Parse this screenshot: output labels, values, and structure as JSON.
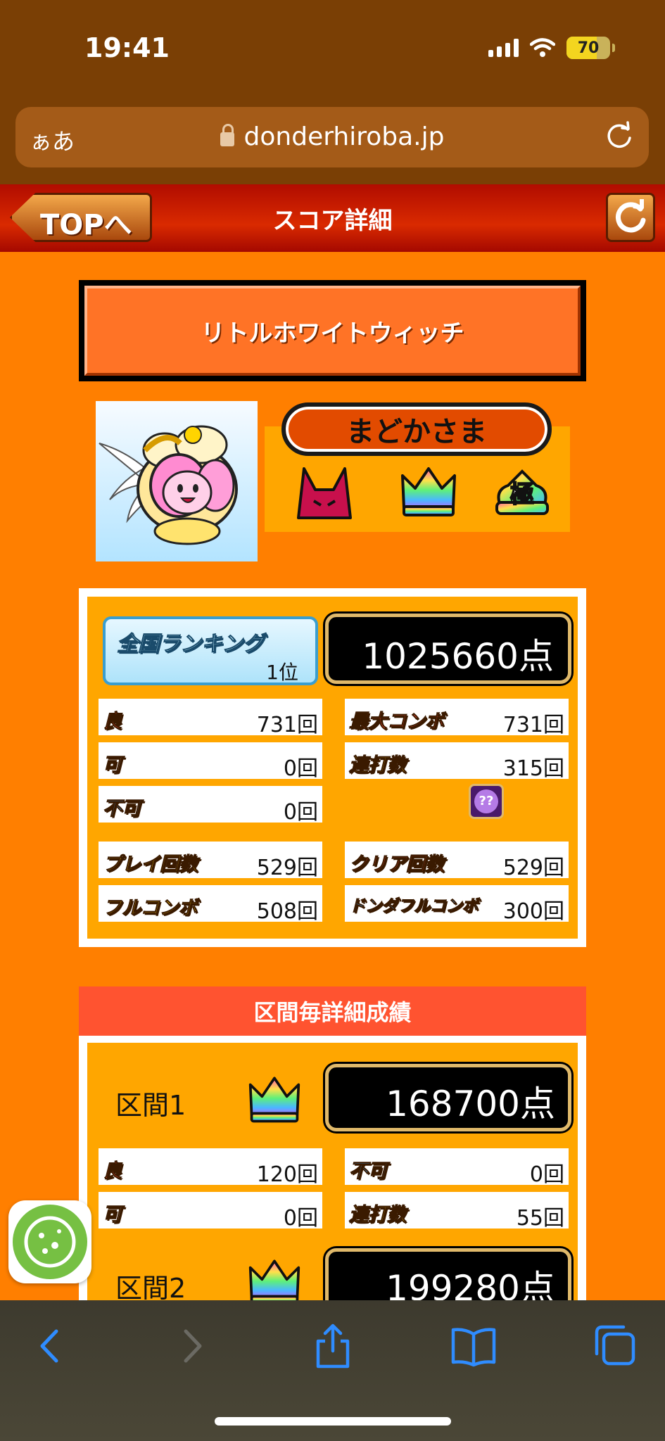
{
  "status_bar": {
    "time": "19:41",
    "battery": "70"
  },
  "url_bar": {
    "text_size": "ぁあ",
    "domain": "donderhiroba.jp"
  },
  "header": {
    "back_label": "TOPへ",
    "title": "スコア詳細"
  },
  "song": {
    "title": "リトルホワイトウィッチ"
  },
  "player": {
    "name": "まどかさま",
    "badges": [
      "oni-difficulty-icon",
      "rainbow-crown-icon",
      "kiwami-rank-icon"
    ]
  },
  "score": {
    "ranking_label": "全国ランキング",
    "ranking_value": "1位",
    "total": "1025660点",
    "stats": {
      "good": {
        "label": "良",
        "value": "731回"
      },
      "ok": {
        "label": "可",
        "value": "0回"
      },
      "bad": {
        "label": "不可",
        "value": "0回"
      },
      "max_combo": {
        "label": "最大コンボ",
        "value": "731回"
      },
      "drumroll": {
        "label": "連打数",
        "value": "315回"
      },
      "play_count": {
        "label": "プレイ回数",
        "value": "529回"
      },
      "full_combo": {
        "label": "フルコンボ",
        "value": "508回"
      },
      "clear_count": {
        "label": "クリア回数",
        "value": "529回"
      },
      "donderful_combo": {
        "label": "ドンダフルコンボ",
        "value": "300回"
      }
    }
  },
  "sections": {
    "header": "区間毎詳細成績",
    "items": [
      {
        "title": "区間1",
        "score": "168700点",
        "good": {
          "label": "良",
          "value": "120回"
        },
        "ok": {
          "label": "可",
          "value": "0回"
        },
        "bad": {
          "label": "不可",
          "value": "0回"
        },
        "drumroll": {
          "label": "連打数",
          "value": "55回"
        }
      },
      {
        "title": "区間2",
        "score": "199280点"
      }
    ]
  },
  "colors": {
    "page_bg": "#ff7f00",
    "panel_orange": "#ffa600",
    "header_red": "#c41a00",
    "section_header": "#ff5330"
  }
}
